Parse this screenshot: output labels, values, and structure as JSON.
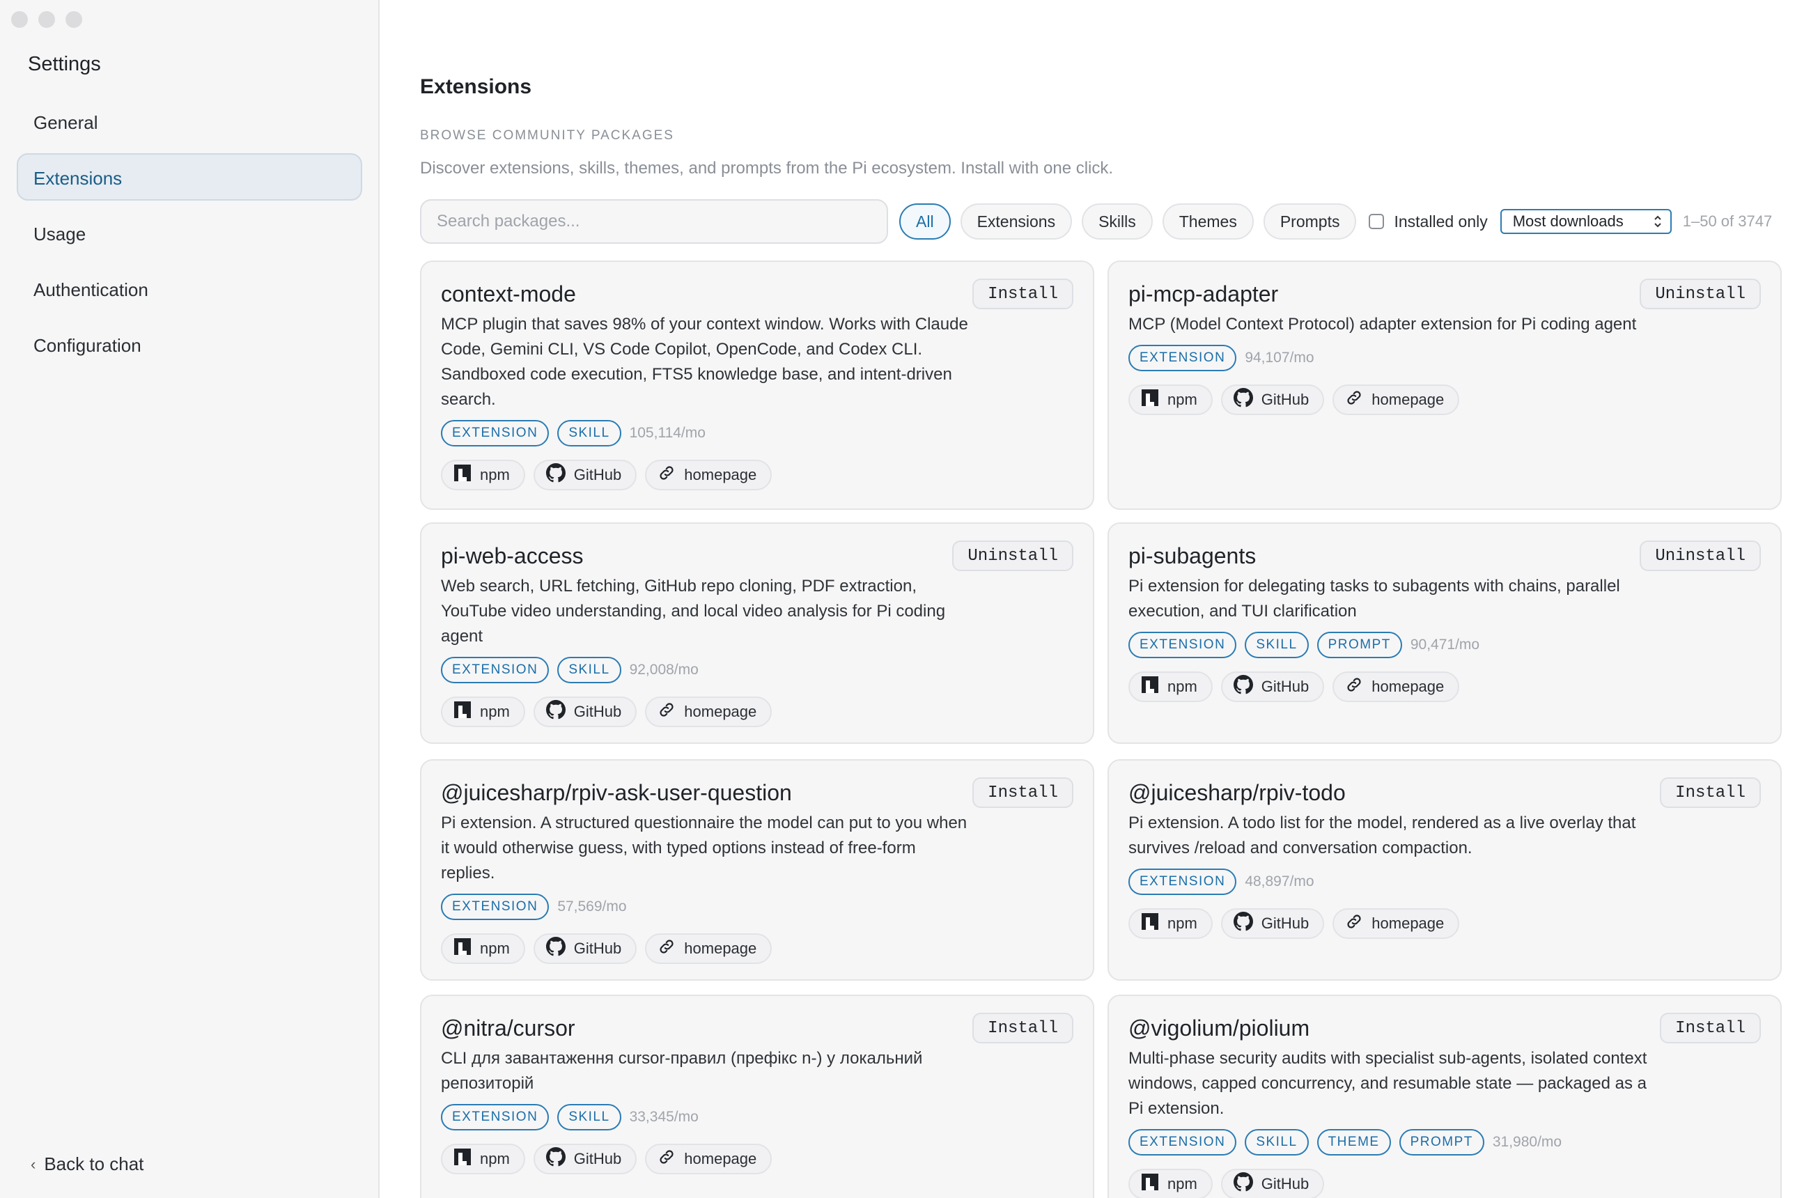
{
  "sidebar": {
    "title": "Settings",
    "items": [
      {
        "label": "General"
      },
      {
        "label": "Extensions"
      },
      {
        "label": "Usage"
      },
      {
        "label": "Authentication"
      },
      {
        "label": "Configuration"
      }
    ],
    "back_label": "Back to chat"
  },
  "main": {
    "title": "Extensions",
    "section_label": "BROWSE COMMUNITY PACKAGES",
    "section_desc": "Discover extensions, skills, themes, and prompts from the Pi ecosystem. Install with one click.",
    "search_placeholder": "Search packages...",
    "filters": [
      "All",
      "Extensions",
      "Skills",
      "Themes",
      "Prompts"
    ],
    "active_filter": "All",
    "installed_only_label": "Installed only",
    "sort_value": "Most downloads",
    "result_count": "1–50 of 3747"
  },
  "link_labels": {
    "npm": "npm",
    "github": "GitHub",
    "homepage": "homepage"
  },
  "packages": [
    {
      "name": "context-mode",
      "description": "MCP plugin that saves 98% of your context window. Works with Claude Code, Gemini CLI, VS Code Copilot, OpenCode, and Codex CLI. Sandboxed code execution, FTS5 knowledge base, and intent-driven search.",
      "action": "Install",
      "tags": [
        "EXTENSION",
        "SKILL"
      ],
      "downloads": "105,114/mo"
    },
    {
      "name": "pi-mcp-adapter",
      "description": "MCP (Model Context Protocol) adapter extension for Pi coding agent",
      "action": "Uninstall",
      "tags": [
        "EXTENSION"
      ],
      "downloads": "94,107/mo"
    },
    {
      "name": "pi-web-access",
      "description": "Web search, URL fetching, GitHub repo cloning, PDF extraction, YouTube video understanding, and local video analysis for Pi coding agent",
      "action": "Uninstall",
      "tags": [
        "EXTENSION",
        "SKILL"
      ],
      "downloads": "92,008/mo"
    },
    {
      "name": "pi-subagents",
      "description": "Pi extension for delegating tasks to subagents with chains, parallel execution, and TUI clarification",
      "action": "Uninstall",
      "tags": [
        "EXTENSION",
        "SKILL",
        "PROMPT"
      ],
      "downloads": "90,471/mo"
    },
    {
      "name": "@juicesharp/rpiv-ask-user-question",
      "description": "Pi extension. A structured questionnaire the model can put to you when it would otherwise guess, with typed options instead of free-form replies.",
      "action": "Install",
      "tags": [
        "EXTENSION"
      ],
      "downloads": "57,569/mo"
    },
    {
      "name": "@juicesharp/rpiv-todo",
      "description": "Pi extension. A todo list for the model, rendered as a live overlay that survives /reload and conversation compaction.",
      "action": "Install",
      "tags": [
        "EXTENSION"
      ],
      "downloads": "48,897/mo"
    },
    {
      "name": "@nitra/cursor",
      "description": "CLI для завантаження cursor-правил (префікс n-) у локальний репозиторій",
      "action": "Install",
      "tags": [
        "EXTENSION",
        "SKILL"
      ],
      "downloads": "33,345/mo"
    },
    {
      "name": "@vigolium/piolium",
      "description": "Multi-phase security audits with specialist sub-agents, isolated context windows, capped concurrency, and resumable state — packaged as a Pi extension.",
      "action": "Install",
      "tags": [
        "EXTENSION",
        "SKILL",
        "THEME",
        "PROMPT"
      ],
      "downloads": "31,980/mo"
    }
  ]
}
